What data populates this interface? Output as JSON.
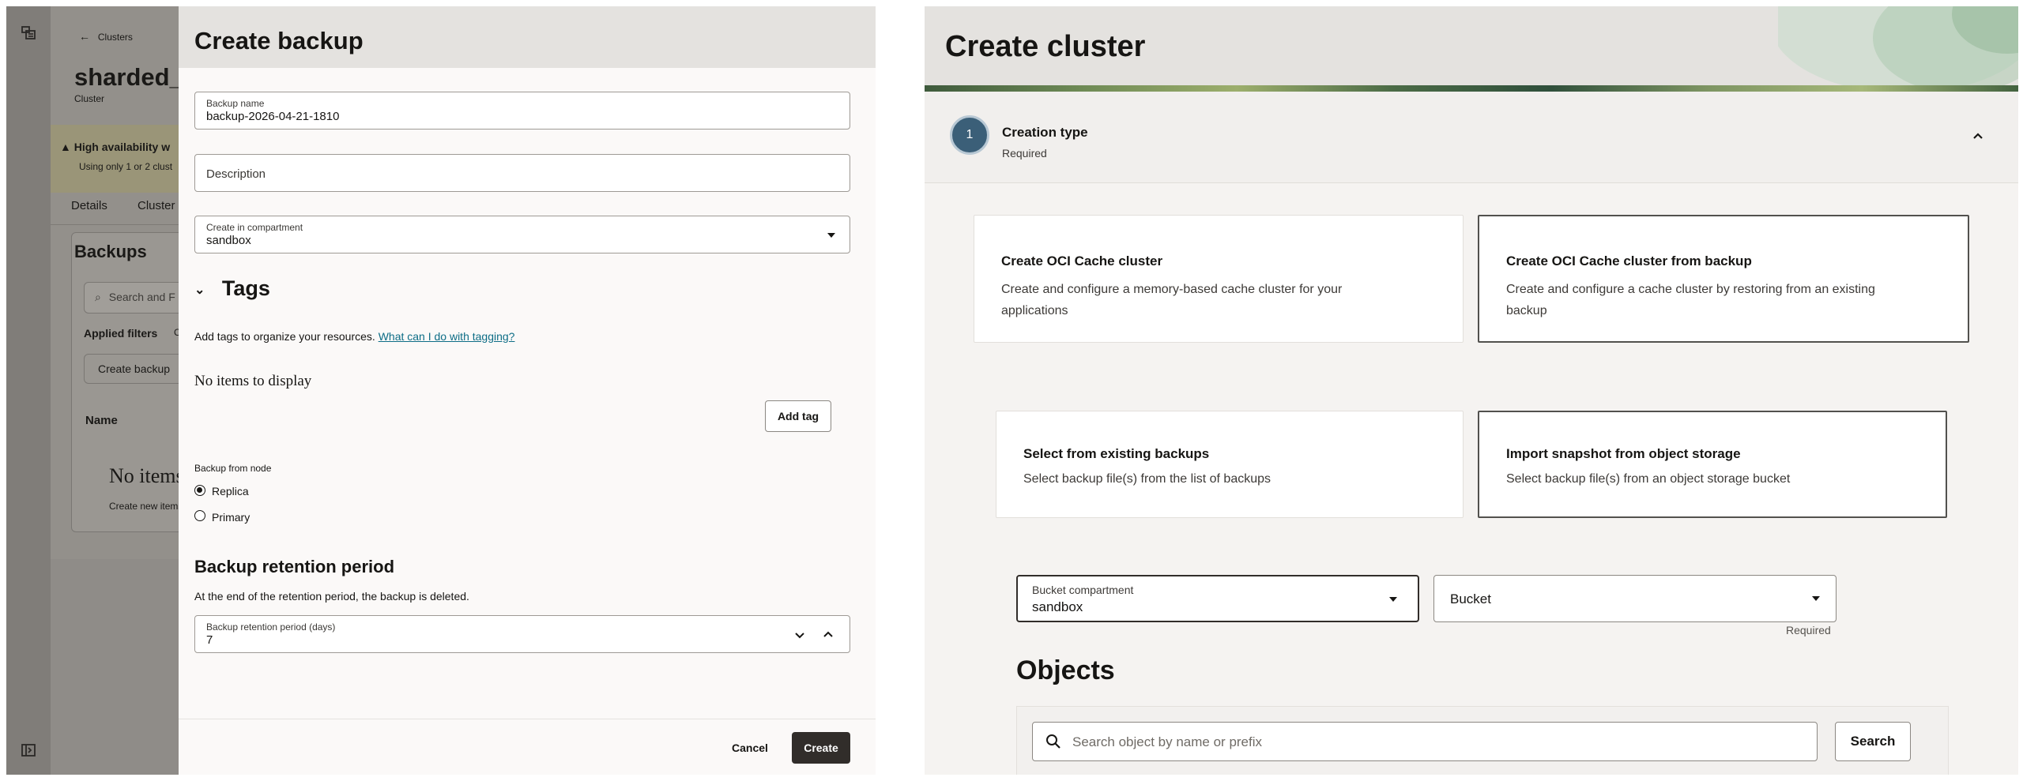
{
  "left": {
    "background": {
      "back_link": "Clusters",
      "cluster_name": "sharded_v",
      "cluster_type": "Cluster",
      "alert_title": "High availability w",
      "alert_text": "Using only 1 or 2 clust",
      "tabs": [
        "Details",
        "Cluster r"
      ],
      "section_title": "Backups",
      "search_placeholder": "Search and F",
      "applied_filters": "Applied filters",
      "applied_filters_trailing": "Co",
      "create_backup": "Create backup",
      "column_name": "Name",
      "empty_title": "No items",
      "empty_sub": "Create new items"
    },
    "drawer": {
      "title": "Create backup",
      "backup_name": {
        "label": "Backup name",
        "value": "backup-2026-04-21-1810"
      },
      "description": {
        "placeholder": "Description"
      },
      "compartment": {
        "label": "Create in compartment",
        "value": "sandbox"
      },
      "tags": {
        "title": "Tags",
        "help_text": "Add tags to organize your resources.",
        "help_link": "What can I do with tagging?",
        "empty": "No items to display",
        "add_tag": "Add tag"
      },
      "backup_from_node": {
        "label": "Backup from node",
        "options": [
          "Replica",
          "Primary"
        ],
        "selected": "Replica"
      },
      "retention": {
        "title": "Backup retention period",
        "help": "At the end of the retention period, the backup is deleted.",
        "label": "Backup retention period (days)",
        "value": "7"
      },
      "footer": {
        "cancel": "Cancel",
        "create": "Create"
      }
    }
  },
  "right": {
    "title": "Create cluster",
    "step": {
      "number": "1",
      "title": "Creation type",
      "subtitle": "Required"
    },
    "type_cards": [
      {
        "title": "Create OCI Cache cluster",
        "desc1": "Create and configure a memory-based cache cluster for your",
        "desc2": "applications",
        "selected": false
      },
      {
        "title": "Create OCI Cache cluster from backup",
        "desc1": "Create and configure a cache cluster by restoring from an existing",
        "desc2": "backup",
        "selected": true
      }
    ],
    "source_cards": [
      {
        "title": "Select from existing backups",
        "desc": "Select backup file(s) from the list of backups",
        "selected": false
      },
      {
        "title": "Import snapshot from object storage",
        "desc": "Select backup file(s) from an object storage bucket",
        "selected": true
      }
    ],
    "bucket_compartment": {
      "label": "Bucket compartment",
      "value": "sandbox"
    },
    "bucket": {
      "placeholder": "Bucket",
      "required": "Required"
    },
    "objects": {
      "title": "Objects",
      "search_placeholder": "Search object by name or prefix",
      "search_button": "Search"
    }
  }
}
